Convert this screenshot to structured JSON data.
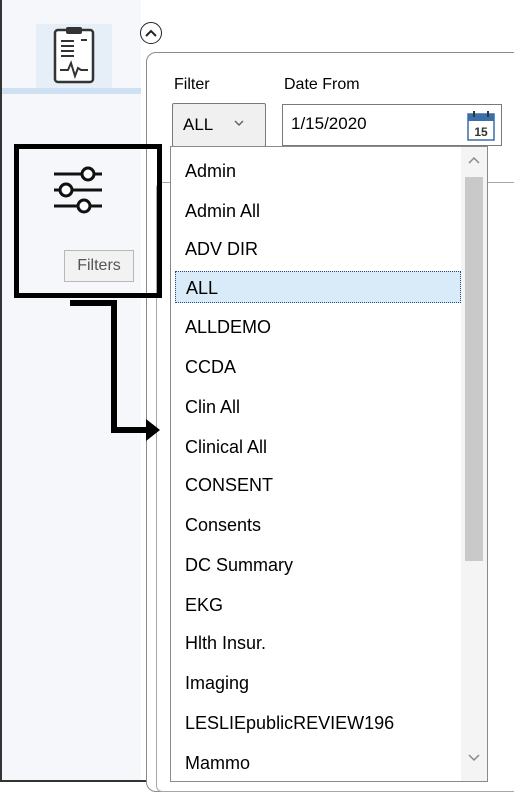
{
  "colors": {
    "selected_bg": "#d9eaf8",
    "highlight_border": "#000000"
  },
  "sidebar": {
    "nav_icon": "clipboard-ekg-icon",
    "filters_icon": "sliders-icon",
    "filters_label": "Filters"
  },
  "header": {
    "collapse_icon": "chevron-up-icon"
  },
  "filter": {
    "label": "Filter",
    "value": "ALL",
    "options": [
      "Admin",
      "Admin All",
      "ADV DIR",
      "ALL",
      "ALLDEMO",
      "CCDA",
      "Clin All",
      "Clinical All",
      "CONSENT",
      "Consents",
      "DC Summary",
      "EKG",
      "Hlth Insur.",
      "Imaging",
      "LESLIEpublicREVIEW196",
      "Mammo"
    ],
    "selected_index": 3
  },
  "date_from": {
    "label": "Date From",
    "value": "1/15/2020",
    "calendar_day": "15"
  }
}
